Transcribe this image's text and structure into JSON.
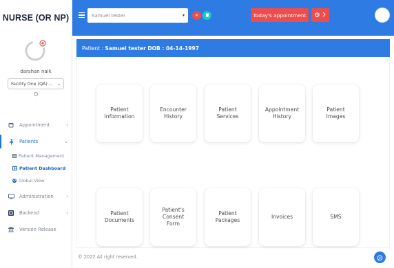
{
  "app": {
    "role_title": "NURSE (OR NP)"
  },
  "profile": {
    "name": "darshan naik",
    "facility": "Facility One (QA) ..."
  },
  "sidebar": {
    "items": [
      {
        "label": "Appointment",
        "icon": "calendar-icon"
      },
      {
        "label": "Patients",
        "icon": "patient-icon",
        "active": true
      },
      {
        "label": "Patient Management",
        "icon": "list-icon"
      },
      {
        "label": "Patient Dashboard",
        "icon": "dashboard-icon",
        "active": true
      },
      {
        "label": "Global View",
        "icon": "globe-icon"
      },
      {
        "label": "Administration",
        "icon": "monitor-icon"
      },
      {
        "label": "Backend",
        "icon": "server-icon"
      },
      {
        "label": "Version Release",
        "icon": "release-icon"
      }
    ]
  },
  "topbar": {
    "search_value": "Samuel tester",
    "appointment_button": "Today's appointment",
    "colors": {
      "bar": "#2e7be4",
      "red": "#ee4d4d",
      "teal": "#19c8c8"
    }
  },
  "patient_bar": {
    "label": "Patient :",
    "text": "Samuel tester  DOB : 04-14-1997"
  },
  "cards": [
    {
      "label": "Patient\nInformation"
    },
    {
      "label": "Encounter\nHistory"
    },
    {
      "label": "Patient\nServices"
    },
    {
      "label": "Appointment\nHistory"
    },
    {
      "label": "Patient\nImages"
    },
    {
      "label": "Patient\nDocuments"
    },
    {
      "label": "Patient's\nConsent\nForm"
    },
    {
      "label": "Patient\nPackages"
    },
    {
      "label": "Invoices"
    },
    {
      "label": "SMS"
    }
  ],
  "footer": {
    "text": "© 2022 All right reserved."
  }
}
